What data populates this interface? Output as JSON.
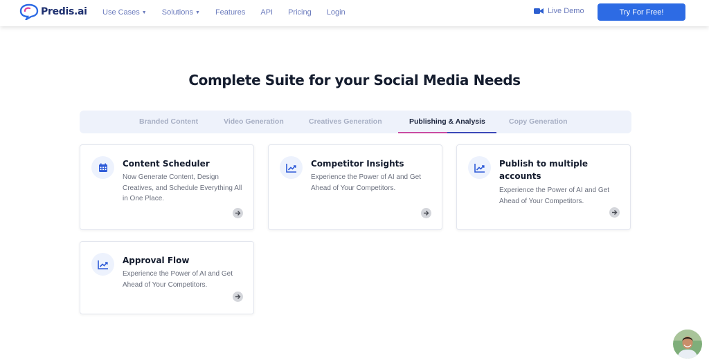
{
  "header": {
    "logo_text": "Predis.ai",
    "nav": [
      {
        "label": "Use Cases",
        "dropdown": true
      },
      {
        "label": "Solutions",
        "dropdown": true
      },
      {
        "label": "Features",
        "dropdown": false
      },
      {
        "label": "API",
        "dropdown": false
      },
      {
        "label": "Pricing",
        "dropdown": false
      },
      {
        "label": "Login",
        "dropdown": false
      }
    ],
    "live_demo": "Live Demo",
    "cta": "Try For Free!"
  },
  "title": "Complete Suite for your Social Media Needs",
  "tabs": [
    {
      "label": "Branded Content",
      "active": false
    },
    {
      "label": "Video Generation",
      "active": false
    },
    {
      "label": "Creatives Generation",
      "active": false
    },
    {
      "label": "Publishing & Analysis",
      "active": true
    },
    {
      "label": "Copy Generation",
      "active": false
    }
  ],
  "cards": [
    {
      "title": "Content Scheduler",
      "icon": "calendar-icon",
      "description": "Now Generate Content, Design Creatives, and Schedule Everything All in One Place."
    },
    {
      "title": "Competitor Insights",
      "icon": "trending-up-icon",
      "description": "Experience the Power of AI and Get Ahead of Your Competitors."
    },
    {
      "title": "Publish to multiple accounts",
      "icon": "trending-up-icon",
      "description": "Experience the Power of AI and Get Ahead of Your Competitors."
    },
    {
      "title": "Approval Flow",
      "icon": "trending-up-icon",
      "description": "Experience the Power of AI and Get Ahead of Your Competitors."
    }
  ],
  "colors": {
    "brand": "#1d2f6f",
    "primary_button": "#2d6be4",
    "nav_text": "#6b7bbd",
    "tab_active_underline": "#c94ba1",
    "icon_blue": "#2e5bd8"
  }
}
